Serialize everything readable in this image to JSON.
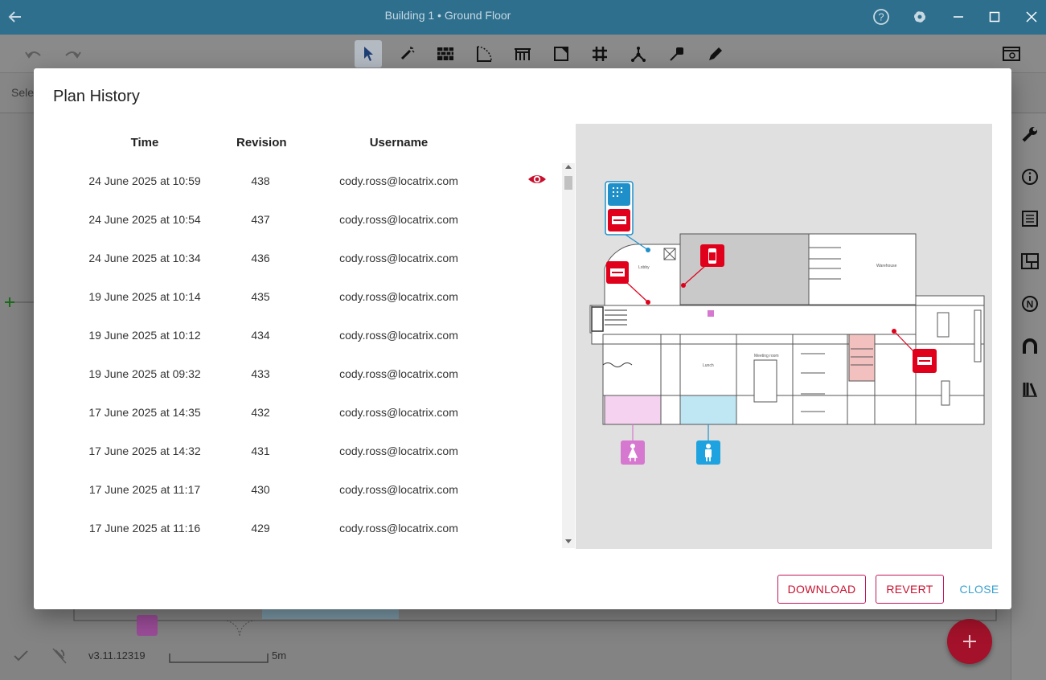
{
  "window": {
    "title": "Building 1 • Ground Floor"
  },
  "subbar": {
    "select_text": "Sele"
  },
  "footer": {
    "version": "v3.11.12319",
    "scale_label": "5m"
  },
  "dialog": {
    "title": "Plan History",
    "columns": {
      "time": "Time",
      "revision": "Revision",
      "username": "Username"
    },
    "rows": [
      {
        "time": "24 June 2025 at 10:59",
        "revision": "438",
        "username": "cody.ross@locatrix.com"
      },
      {
        "time": "24 June 2025 at 10:54",
        "revision": "437",
        "username": "cody.ross@locatrix.com"
      },
      {
        "time": "24 June 2025 at 10:34",
        "revision": "436",
        "username": "cody.ross@locatrix.com"
      },
      {
        "time": "19 June 2025 at 10:14",
        "revision": "435",
        "username": "cody.ross@locatrix.com"
      },
      {
        "time": "19 June 2025 at 10:12",
        "revision": "434",
        "username": "cody.ross@locatrix.com"
      },
      {
        "time": "19 June 2025 at 09:32",
        "revision": "433",
        "username": "cody.ross@locatrix.com"
      },
      {
        "time": "17 June 2025 at 14:35",
        "revision": "432",
        "username": "cody.ross@locatrix.com"
      },
      {
        "time": "17 June 2025 at 14:32",
        "revision": "431",
        "username": "cody.ross@locatrix.com"
      },
      {
        "time": "17 June 2025 at 11:17",
        "revision": "430",
        "username": "cody.ross@locatrix.com"
      },
      {
        "time": "17 June 2025 at 11:16",
        "revision": "429",
        "username": "cody.ross@locatrix.com"
      }
    ],
    "viewing_row_index": 0,
    "preview_labels": {
      "lobby": "Lobby",
      "warehouse": "Warehouse",
      "lunch": "Lunch",
      "meeting": "Meeting room"
    },
    "buttons": {
      "download": "DOWNLOAD",
      "revert": "REVERT",
      "close": "CLOSE"
    }
  },
  "colors": {
    "titlebar": "#2e6f8e",
    "accent_red": "#c8102e",
    "accent_blue": "#3aa0d0",
    "fab": "#a3122a"
  },
  "icons": {
    "titlebar": [
      "back-arrow-icon",
      "help-icon",
      "gear-icon",
      "minimize-icon",
      "maximize-icon",
      "close-icon"
    ],
    "toolbar": [
      "undo-icon",
      "redo-icon",
      "select-pointer-icon",
      "magic-wand-icon",
      "wall-icon",
      "door-arc-icon",
      "stairs-icon",
      "room-icon",
      "grid-move-icon",
      "node-icon",
      "marker-icon",
      "pencil-icon",
      "layers-icon"
    ],
    "rightbar": [
      "wrench-icon",
      "info-icon",
      "list-icon",
      "plan-icon",
      "north-icon",
      "magnet-icon",
      "library-icon"
    ]
  }
}
